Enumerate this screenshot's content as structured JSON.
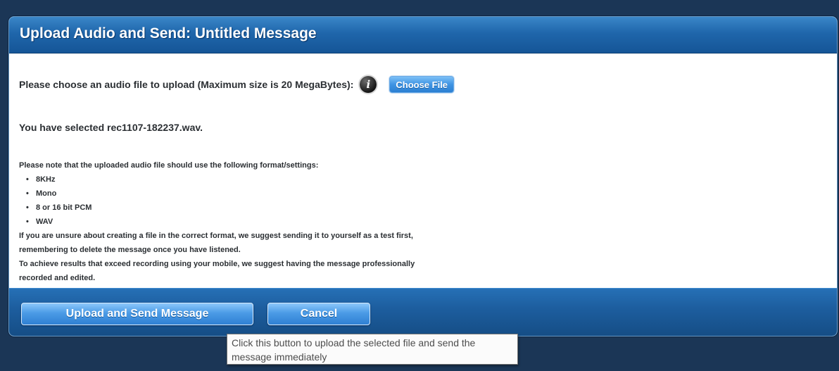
{
  "dialog": {
    "title": "Upload Audio and Send: Untitled Message"
  },
  "upload": {
    "prompt": "Please choose an audio file to upload (Maximum size is 20 MegaBytes):",
    "info_icon": "info-icon",
    "choose_file_label": "Choose File",
    "selected_text": "You have selected rec1107-182237.wav."
  },
  "notes": {
    "intro": "Please note that the uploaded audio file should use the following format/settings:",
    "bullets": [
      "8KHz",
      "Mono",
      "8 or 16 bit PCM",
      "WAV"
    ],
    "unsure_line1": "If you are unsure about creating a file in the correct format, we suggest sending it to yourself as a test first,",
    "unsure_line2": "remembering to delete the message once you have listened.",
    "achieve_line1": "To achieve results that exceed recording using your mobile, we suggest having the message professionally",
    "achieve_line2": "recorded and edited."
  },
  "footer": {
    "upload_send_label": "Upload and Send Message",
    "cancel_label": "Cancel"
  },
  "tooltip": {
    "line1": "Click this button to upload the selected file and send the",
    "line2": "message immediately"
  },
  "colors": {
    "header_blue": "#1f66ab",
    "button_blue": "#4b9be6",
    "backdrop": "#1b3656"
  }
}
